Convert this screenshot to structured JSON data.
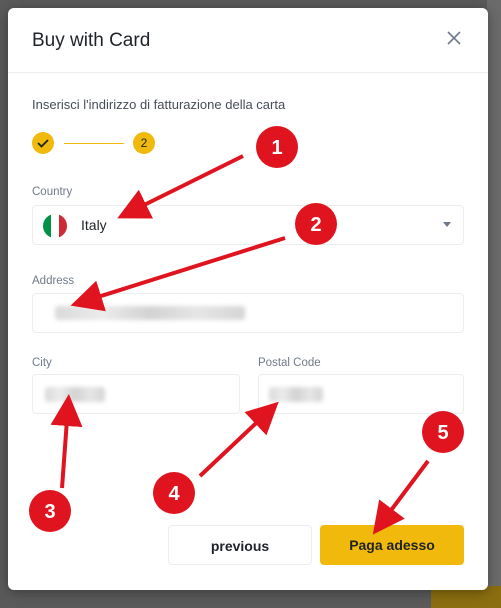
{
  "modal": {
    "title": "Buy with Card",
    "instruction": "Inserisci l'indirizzo di fatturazione della carta",
    "stepper": {
      "current_step": "2"
    }
  },
  "form": {
    "country": {
      "label": "Country",
      "value": "Italy",
      "flag_colors": [
        "#009246",
        "#ffffff",
        "#ce2b37"
      ]
    },
    "address": {
      "label": "Address"
    },
    "city": {
      "label": "City"
    },
    "postal_code": {
      "label": "Postal Code"
    }
  },
  "buttons": {
    "previous": "previous",
    "pay": "Paga adesso"
  },
  "annotations": [
    "1",
    "2",
    "3",
    "4",
    "5"
  ],
  "colors": {
    "accent": "#f0b90b",
    "annotation": "#e0141e"
  }
}
